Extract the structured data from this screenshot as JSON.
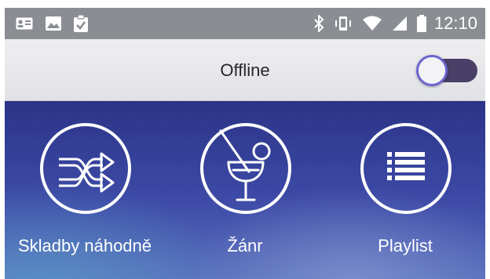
{
  "status_bar": {
    "time": "12:10",
    "left_icons": [
      "contact-card-icon",
      "image-icon",
      "clipboard-check-icon"
    ],
    "right_icons": [
      "bluetooth-icon",
      "vibrate-icon",
      "wifi-icon",
      "cell-signal-icon",
      "battery-icon"
    ]
  },
  "header": {
    "title": "Offline",
    "offline_toggle_on": false
  },
  "tiles": [
    {
      "label": "Skladby náhodně",
      "icon": "shuffle-icon"
    },
    {
      "label": "Žánr",
      "icon": "cocktail-glass-icon"
    },
    {
      "label": "Playlist",
      "icon": "playlist-icon"
    }
  ],
  "colors": {
    "status_bar": "#8a8d92",
    "header_bg": "#e6e7ea",
    "main_bg_top": "#2b3487",
    "main_bg_bottom": "#5a6fbe",
    "toggle_track": "#4a3f67",
    "toggle_accent": "#6e66cf"
  }
}
